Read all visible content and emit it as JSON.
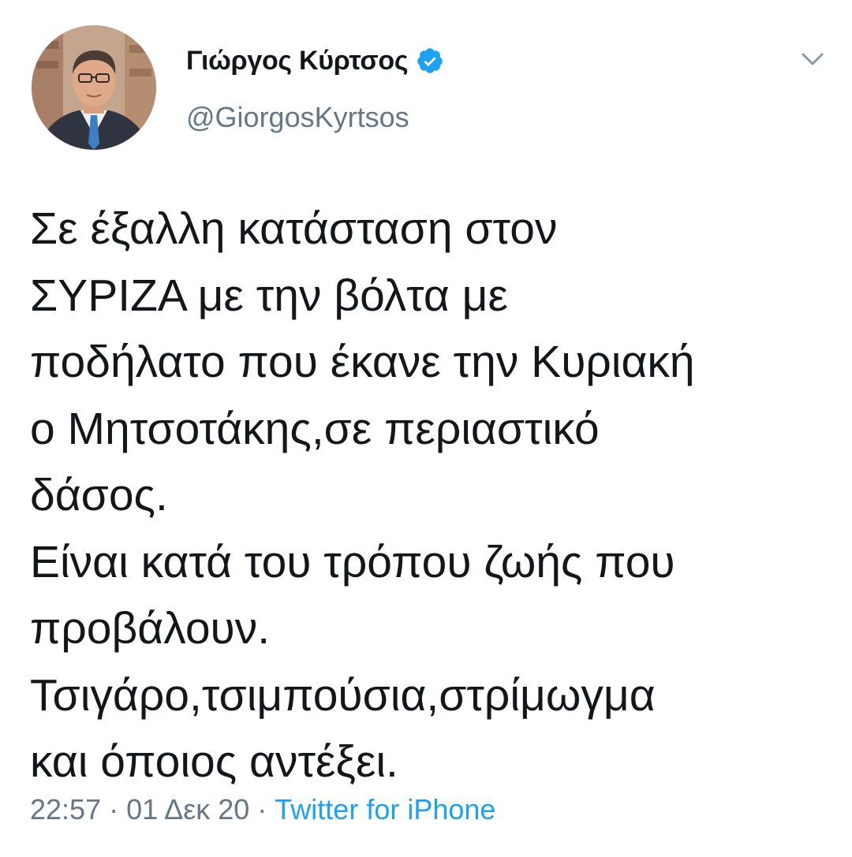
{
  "author": {
    "display_name": "Γιώργος Κύρτσος",
    "handle": "@GiorgosKyrtsos",
    "verified": true
  },
  "tweet": {
    "lines": [
      "Σε έξαλλη κατάσταση στον",
      "ΣΥΡΙΖΑ με την βόλτα με",
      "ποδήλατο που έκανε την Κυριακή",
      "ο Μητσοτάκης,σε περιαστικό",
      "δάσος.",
      "Είναι κατά του τρόπου ζωής που",
      "προβάλουν.",
      "Τσιγάρο,τσιμπούσια,στρίμωγμα",
      "και όποιος αντέξει."
    ]
  },
  "meta": {
    "time": "22:57",
    "separator": " · ",
    "date": "01 Δεκ 20",
    "source": "Twitter for iPhone"
  },
  "colors": {
    "text": "#14171a",
    "secondary": "#657786",
    "link": "#1da1f2",
    "verified": "#1da1f2"
  },
  "icons": {
    "verified": "verified-badge-icon",
    "caret": "chevron-down-icon"
  }
}
